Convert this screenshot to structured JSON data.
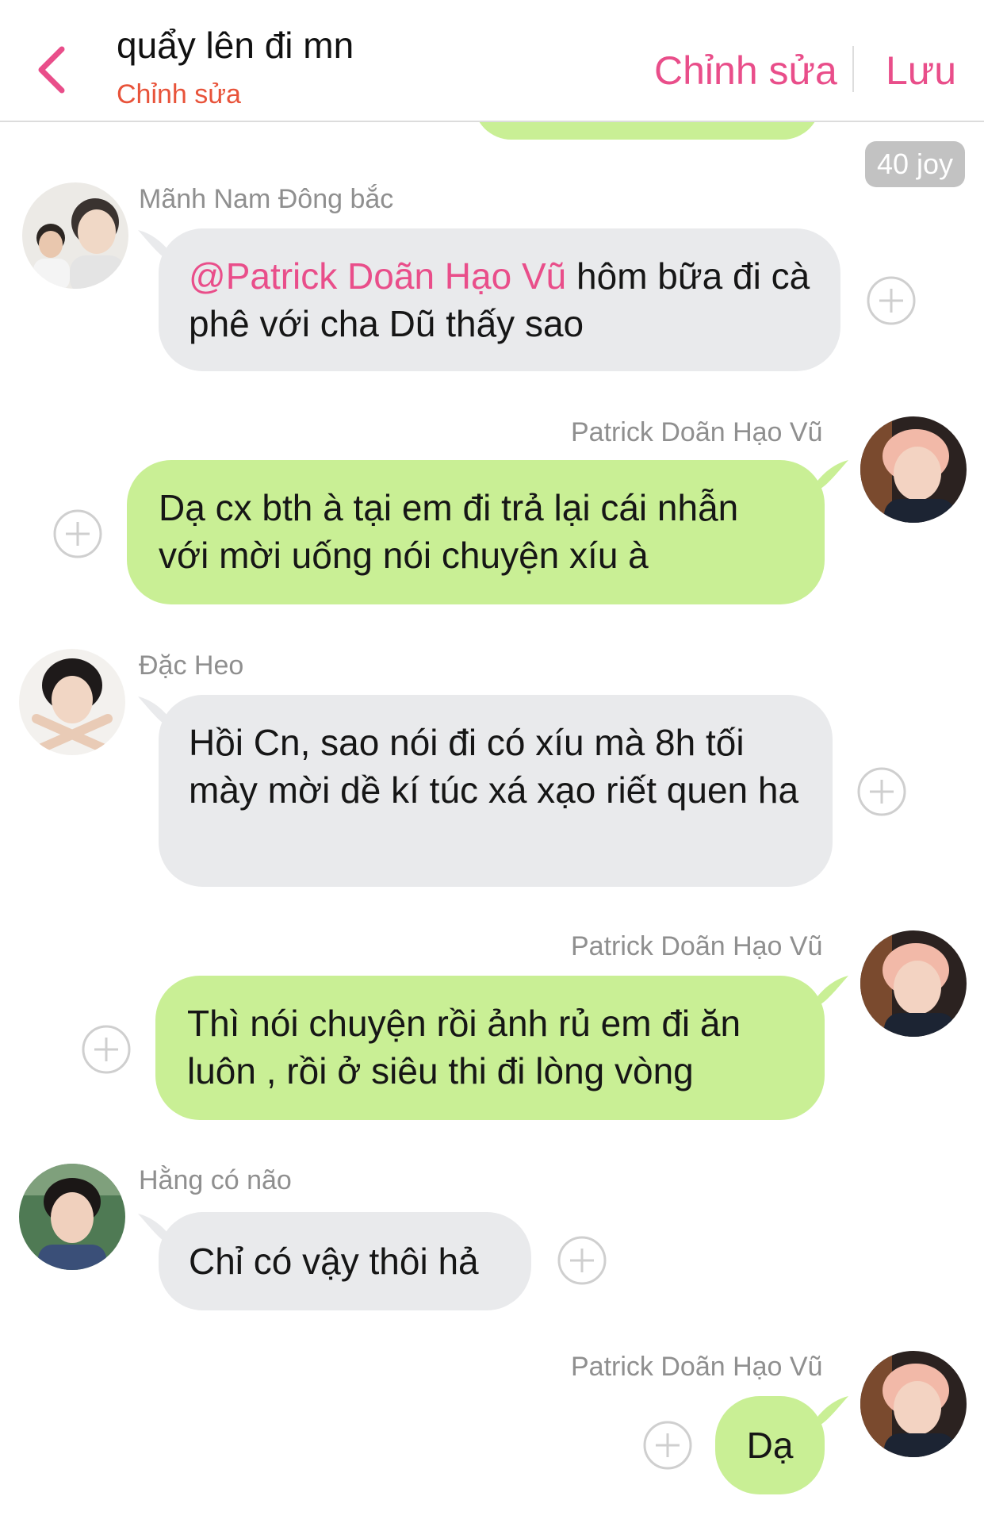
{
  "header": {
    "title": "quẩy lên đi mn",
    "subtitle": "Chỉnh sửa",
    "edit_label": "Chỉnh sửa",
    "save_label": "Lưu",
    "back_icon": "chevron-left-icon"
  },
  "colors": {
    "accent_pink": "#e94e8a",
    "subtitle_orange": "#e8533a",
    "incoming_bubble": "#e9eaec",
    "outgoing_bubble": "#c9ef95",
    "badge": "#c2c2c2"
  },
  "badge": {
    "text": "40 joy"
  },
  "messages": [
    {
      "sender": "Mãnh Nam Đông bắc",
      "mention": "@Patrick Doãn Hạo Vũ",
      "text": " hôm bữa đi cà phê với cha Dũ thấy sao",
      "direction": "incoming"
    },
    {
      "sender": "Patrick Doãn Hạo Vũ",
      "text": "Dạ cx bth à tại em đi trả lại cái nhẫn với mời uống nói chuyện xíu à",
      "direction": "outgoing"
    },
    {
      "sender": "Đặc Heo",
      "text": "Hồi Cn, sao nói đi có xíu mà 8h tối mày mời dề kí túc xá xạo riết quen ha",
      "direction": "incoming"
    },
    {
      "sender": "Patrick Doãn Hạo Vũ",
      "text": "Thì nói chuyện rồi ảnh rủ em đi ăn luôn , rồi ở siêu thi đi lòng vòng",
      "direction": "outgoing"
    },
    {
      "sender": "Hằng có não",
      "text": "Chỉ có vậy thôi hả",
      "direction": "incoming"
    },
    {
      "sender": "Patrick Doãn Hạo Vũ",
      "text": "Dạ",
      "direction": "outgoing"
    }
  ],
  "icons": {
    "reaction_add": "plus-circle-icon",
    "avatar": "avatar-photo"
  }
}
